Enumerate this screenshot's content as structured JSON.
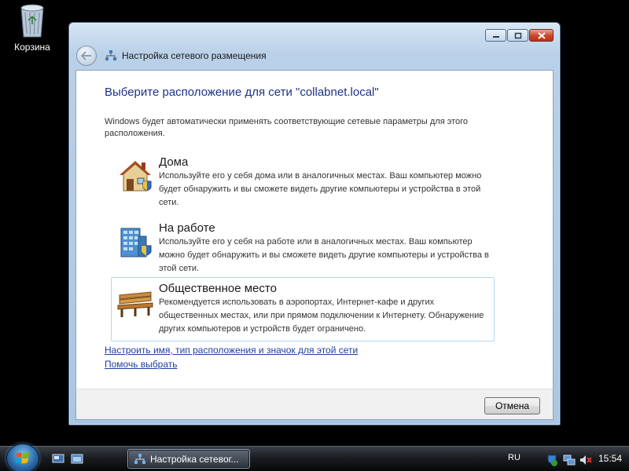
{
  "desktop": {
    "recycle_bin_label": "Корзина"
  },
  "window": {
    "title": "Настройка сетевого размещения",
    "heading": "Выберите расположение для сети \"collabnet.local\"",
    "intro": "Windows будет автоматически применять соответствующие сетевые параметры для этого расположения.",
    "options": [
      {
        "title": "Дома",
        "description": "Используйте его у себя дома или в аналогичных местах. Ваш компьютер можно будет обнаружить и вы сможете видеть другие компьютеры и устройства в этой сети.",
        "icon": "house-icon"
      },
      {
        "title": "На работе",
        "description": "Используйте его у себя на работе или в аналогичных местах. Ваш компьютер можно будет обнаружить и вы сможете видеть другие компьютеры и устройства в этой сети.",
        "icon": "office-building-icon"
      },
      {
        "title": "Общественное место",
        "description": "Рекомендуется использовать в аэропортах, Интернет-кафе и других общественных местах, или при прямом подключении к Интернету. Обнаружение других компьютеров и устройств будет ограничено.",
        "icon": "park-bench-icon"
      }
    ],
    "links": {
      "customize": "Настроить имя, тип расположения и значок для этой сети",
      "help": "Помочь выбрать"
    },
    "cancel_label": "Отмена"
  },
  "taskbar": {
    "task_button_label": "Настройка сетевог...",
    "language": "RU",
    "clock": "15:54"
  },
  "colors": {
    "heading": "#1e3287",
    "link": "#1e3fa0",
    "selected_border": "#b4d7ef"
  }
}
